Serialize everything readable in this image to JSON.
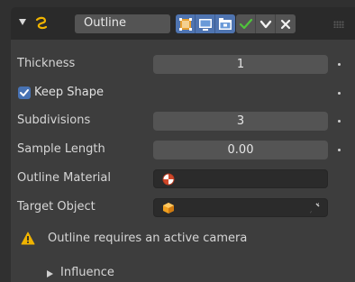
{
  "header": {
    "name_value": "Outline",
    "icons": [
      "modifier-icon",
      "edit-mode-icon",
      "viewport-icon",
      "render-icon",
      "apply-check-icon",
      "dropdown-chevron-icon",
      "close-icon",
      "drag-grip-icon"
    ]
  },
  "fields": {
    "thickness": {
      "label": "Thickness",
      "value": "1"
    },
    "keep_shape": {
      "label": "Keep Shape",
      "checked": true
    },
    "subdivisions": {
      "label": "Subdivisions",
      "value": "3"
    },
    "sample_length": {
      "label": "Sample Length",
      "value": "0.00"
    },
    "outline_material": {
      "label": "Outline Material",
      "value": ""
    },
    "target_object": {
      "label": "Target Object",
      "value": ""
    }
  },
  "warning": {
    "text": "Outline requires an active camera"
  },
  "subpanel": {
    "label": "Influence"
  },
  "colors": {
    "accent": "#4772b3",
    "panel_bg": "#3d3d3d",
    "header_bg": "#2a2a2a",
    "warning": "#f0b400",
    "check_green": "#4fc53b"
  }
}
